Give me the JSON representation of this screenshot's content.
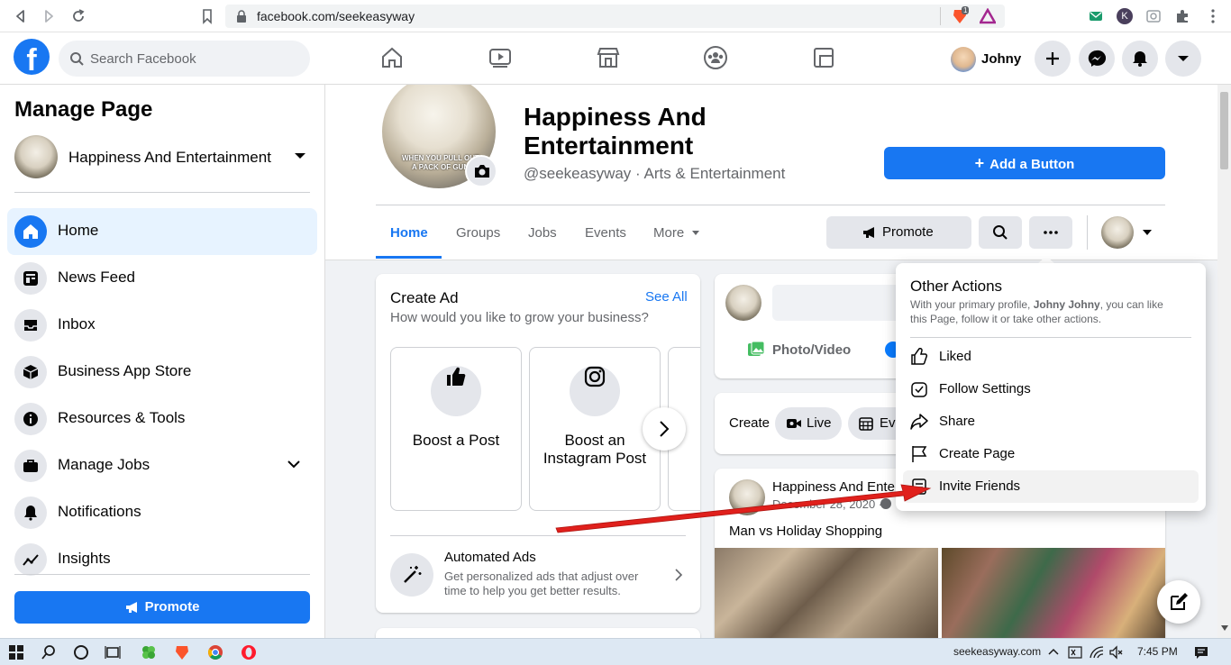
{
  "browser": {
    "url": "facebook.com/seekeasyway",
    "ext_badge": "1",
    "profile_initial": "K"
  },
  "header": {
    "logo": "f",
    "search_placeholder": "Search Facebook",
    "user_name": "Johny",
    "nav_icons": [
      "home-icon",
      "watch-icon",
      "marketplace-icon",
      "groups-icon",
      "gaming-icon"
    ]
  },
  "sidebar": {
    "title": "Manage Page",
    "page_name": "Happiness And Entertainment",
    "items": [
      {
        "label": "Home",
        "icon": "home-icon"
      },
      {
        "label": "News Feed",
        "icon": "news-feed-icon"
      },
      {
        "label": "Inbox",
        "icon": "inbox-icon"
      },
      {
        "label": "Business App Store",
        "icon": "cube-icon"
      },
      {
        "label": "Resources & Tools",
        "icon": "info-icon"
      },
      {
        "label": "Manage Jobs",
        "icon": "briefcase-icon"
      },
      {
        "label": "Notifications",
        "icon": "bell-icon"
      },
      {
        "label": "Insights",
        "icon": "insights-icon"
      }
    ],
    "promote_label": "Promote"
  },
  "page": {
    "name_line1": "Happiness And",
    "name_line2": "Entertainment",
    "handle": "@seekeasyway · Arts & Entertainment",
    "profile_caption_1": "WHEN YOU PULL OUT",
    "profile_caption_2": "A PACK OF GUM",
    "add_button_label": "Add a Button",
    "tabs": [
      "Home",
      "Groups",
      "Jobs",
      "Events",
      "More"
    ],
    "promote_label": "Promote"
  },
  "create_ad": {
    "title": "Create Ad",
    "see_all": "See All",
    "subtitle": "How would you like to grow your business?",
    "options": [
      "Boost a Post",
      "Boost an Instagram Post"
    ],
    "automated_title": "Automated Ads",
    "automated_desc_1": "Get personalized ads that adjust over",
    "automated_desc_2": "time to help you get better results."
  },
  "composer": {
    "photo_video": "Photo/Video"
  },
  "create_bar": {
    "label": "Create",
    "live": "Live",
    "event": "Eve"
  },
  "post": {
    "author": "Happiness And Ente",
    "date": "December 28, 2020 ·",
    "text": "Man vs Holiday Shopping"
  },
  "menu": {
    "title": "Other Actions",
    "desc_1": "With your primary profile, ",
    "desc_name": "Johny Johny",
    "desc_2": ", you can like",
    "desc_3": "this Page, follow it or take other actions.",
    "items": [
      {
        "label": "Liked",
        "icon": "thumbs-up-icon"
      },
      {
        "label": "Follow Settings",
        "icon": "follow-settings-icon"
      },
      {
        "label": "Share",
        "icon": "share-icon"
      },
      {
        "label": "Create Page",
        "icon": "flag-icon"
      },
      {
        "label": "Invite Friends",
        "icon": "invite-friends-icon"
      }
    ]
  },
  "taskbar": {
    "site": "seekeasyway.com",
    "time": "7:45 PM"
  },
  "colors": {
    "fb_blue": "#1877f2",
    "arrow_red": "#e0201c"
  }
}
